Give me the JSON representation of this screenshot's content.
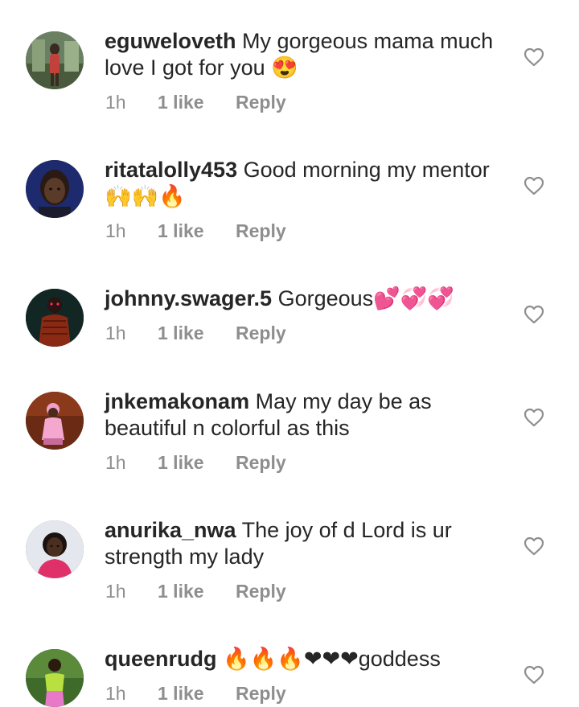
{
  "comments": [
    {
      "username": "eguweloveth",
      "lines": [
        "My gorgeous mama much",
        "love I got for you 😍"
      ],
      "time": "1h",
      "likes": "1 like",
      "reply": "Reply"
    },
    {
      "username": "ritatalolly453",
      "lines": [
        "Good morning my mentor",
        "🙌🙌🔥"
      ],
      "time": "1h",
      "likes": "1 like",
      "reply": "Reply"
    },
    {
      "username": "johnny.swager.5",
      "lines": [
        "Gorgeous💕💞💞"
      ],
      "time": "1h",
      "likes": "1 like",
      "reply": "Reply"
    },
    {
      "username": "jnkemakonam",
      "lines": [
        "May my day be as",
        "beautiful n colorful as this"
      ],
      "time": "1h",
      "likes": "1 like",
      "reply": "Reply"
    },
    {
      "username": "anurika_nwa",
      "lines": [
        "The joy of d Lord is ur",
        "strength my lady"
      ],
      "time": "1h",
      "likes": "1 like",
      "reply": "Reply"
    },
    {
      "username": "queenrudg",
      "lines": [
        "🔥🔥🔥❤❤❤goddess"
      ],
      "time": "1h",
      "likes": "1 like",
      "reply": "Reply"
    }
  ],
  "icons": {
    "like": "heart-outline-icon"
  },
  "colors": {
    "text": "#262626",
    "meta": "#8e8e8e",
    "heart_outline": "#8e8e8e"
  }
}
